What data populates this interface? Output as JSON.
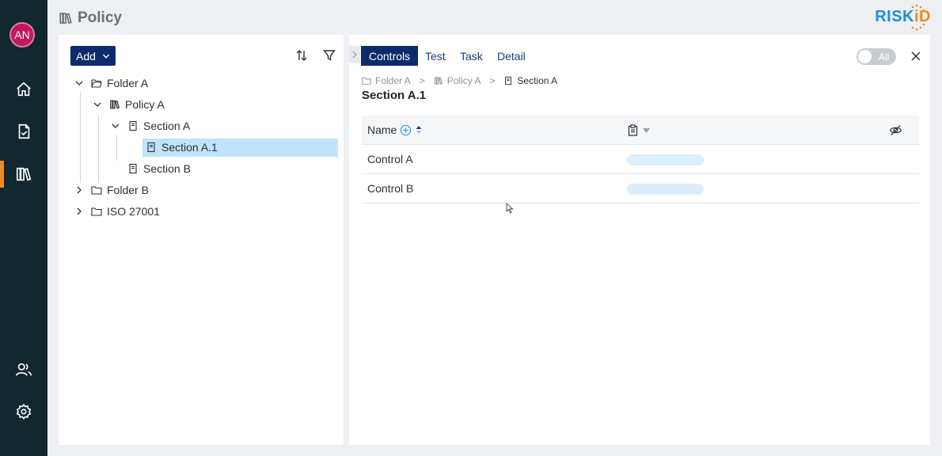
{
  "sidebar": {
    "avatar_initials": "AN",
    "items": [
      {
        "icon": "home-icon"
      },
      {
        "icon": "checklist-icon"
      },
      {
        "icon": "library-icon",
        "active": true
      },
      {
        "icon": "users-icon"
      },
      {
        "icon": "gear-icon"
      }
    ]
  },
  "header": {
    "title": "Policy",
    "logo_main": "RISK",
    "logo_accent": "iD"
  },
  "left_panel": {
    "add_label": "Add",
    "tree": [
      {
        "label": "Folder A",
        "icon": "folder-open-icon",
        "expanded": true
      },
      {
        "label": "Policy A",
        "icon": "library-icon",
        "expanded": true
      },
      {
        "label": "Section A",
        "icon": "document-icon",
        "expanded": true
      },
      {
        "label": "Section A.1",
        "icon": "document-icon",
        "selected": true
      },
      {
        "label": "Section B",
        "icon": "document-icon"
      },
      {
        "label": "Folder B",
        "icon": "folder-icon",
        "expanded": false
      },
      {
        "label": "ISO 27001",
        "icon": "folder-icon",
        "expanded": false
      }
    ]
  },
  "right_panel": {
    "tabs": [
      {
        "label": "Controls",
        "active": true
      },
      {
        "label": "Test"
      },
      {
        "label": "Task"
      },
      {
        "label": "Detail"
      }
    ],
    "toggle_label": "All",
    "breadcrumb": [
      "Folder A",
      "Policy A",
      "Section A"
    ],
    "breadcrumb_sep": ">",
    "section_title": "Section A.1",
    "table": {
      "columns": [
        "Name"
      ],
      "rows": [
        {
          "name": "Control A"
        },
        {
          "name": "Control B"
        }
      ]
    }
  },
  "colors": {
    "sidebar_bg": "#10282e",
    "accent_orange": "#f08a24",
    "primary_navy": "#0d2b6b",
    "selected_bg": "#bfe4fb",
    "avatar_bg": "#c2185b"
  }
}
